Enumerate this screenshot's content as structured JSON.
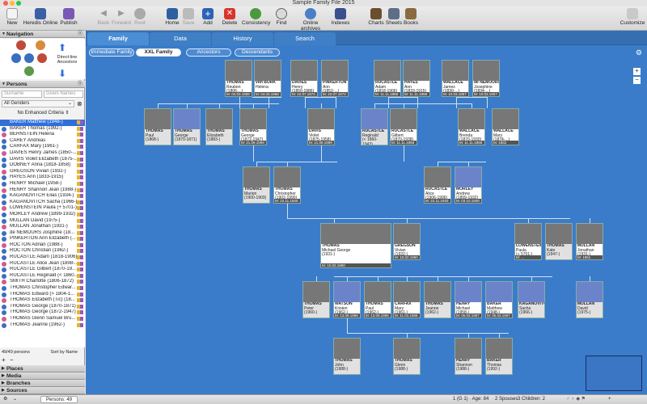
{
  "window": {
    "title": "Sample Family File 2015"
  },
  "toolbar": {
    "new": "New",
    "heredis_online": "Heredis Online",
    "publish": "Publish",
    "back": "Back",
    "forward": "Forward",
    "root": "Root",
    "home": "Home",
    "save": "Save",
    "add": "Add",
    "delete": "Delete",
    "consistency": "Consistency",
    "find": "Find",
    "online_archives": "Online archives",
    "indexes": "Indexes",
    "charts": "Charts",
    "sheets": "Sheets",
    "books": "Books",
    "customize": "Customize"
  },
  "navigation": {
    "title": "Navigation",
    "direct_line": "Direct-line Ancestors"
  },
  "persons": {
    "title": "Persons",
    "surname_placeholder": "Surname",
    "given_placeholder": "Given Names",
    "gender_filter": "All Genders",
    "criteria": "No Enhanced Criteria",
    "count": "49/49 persons",
    "sort": "Sort by Name",
    "items": [
      "BAKER Matthew (1948-)",
      "BAKER Thomas (1992-)",
      "BERNSTEIN Helena",
      "CAREY Andreas",
      "CARFAX Mary (1961-)",
      "DAVIES Henry James (1850-...",
      "DAVIS Violet Elizabeth (1875-...",
      "DOBNEY Anna (1818-1858)",
      "GREGSON Vivian (1932-)",
      "HAYES Ann (1833-1915)",
      "HENRY Michael (1958-)",
      "HENRY Shannon Jean (1988-)",
      "KAGANOVITCH Elias (1934-)",
      "KAGANOVITCH Sacha (1966-)",
      "LOWENSTEIN Paula (+ 5701-)",
      "MORLEY Andrew (1899-1932)",
      "MULLAN David (1975-)",
      "MULLAN Jonathan (1931-)",
      "de NEMOURS Josphine (18...",
      "PINKERTON Ann Elizabeth (...",
      "ROCTON Adrian (1988-)",
      "ROCTON Christian (1962-)",
      "RUCASTLE Adam (1818-1906)",
      "RUCASTLE Alice Jean (1898-...",
      "RUCASTLE Gilbert (1870-19...",
      "RUCASTLE Reginald (< 1860...",
      "SMITH Charlotte (1806-1872)",
      "THOMAS Christopher Edwar...",
      "THOMAS Edward (> 1804-1...",
      "THOMAS Elizabeth (Tic) (18...",
      "THOMAS George (1870-1871)",
      "THOMAS George (1872-1947)",
      "THOMAS Glenn Samuel Bru...",
      "THOMAS Jeanne (1962-)"
    ]
  },
  "sidebar_sections": {
    "places": "Places",
    "media": "Media",
    "branches": "Branches",
    "sources": "Sources"
  },
  "tabs": {
    "family": "Family",
    "data": "Data",
    "history": "History",
    "search": "Search"
  },
  "subtabs": {
    "immediate": "Immediate Family",
    "xxl": "XXL Family",
    "ancestors": "Ancestors",
    "descendants": "Descendants"
  },
  "cards": [
    {
      "n": "THOMAS",
      "g": "Reuben",
      "d": "(1806-...)",
      "s": "M: 04.03.1868",
      "sil": false
    },
    {
      "n": "von BORK",
      "g": "Helena",
      "d": "",
      "s": "M: 04.03.1868",
      "sil": false
    },
    {
      "n": "DAVIES",
      "g": "Henry",
      "d": "(1850-1886)",
      "s": "M: 22.07.1874",
      "sil": false
    },
    {
      "n": "PINKERTON",
      "g": "Ann",
      "d": "(1852-...)",
      "s": "M: 22.07.1874",
      "sil": false
    },
    {
      "n": "RUCASTLE",
      "g": "Adam",
      "d": "(1818-1906)",
      "s": "M: 11.11.1858",
      "sil": false
    },
    {
      "n": "HAYES",
      "g": "Ann",
      "d": "(1833-1915)",
      "s": "M: 11.11.1858",
      "sil": false
    },
    {
      "n": "WALLACE",
      "g": "James",
      "d": "(1830-...)",
      "s": "M: 10.03.1857",
      "sil": false
    },
    {
      "n": "de NEMOURS",
      "g": "Josephine",
      "d": "(1834-...)",
      "s": "M: 10.03.1857",
      "sil": false
    },
    {
      "n": "THOMAS",
      "g": "Paul",
      "d": "(1868-)",
      "s": "",
      "sil": false
    },
    {
      "n": "THOMAS",
      "g": "George",
      "d": "(1870-1871)",
      "s": "",
      "sil": true
    },
    {
      "n": "THOMAS",
      "g": "Elizabeth",
      "d": "(1883-)",
      "s": "",
      "sil": false
    },
    {
      "n": "THOMAS",
      "g": "George",
      "d": "(1872-1947)",
      "s": "M: 21.09.1899",
      "sil": false
    },
    {
      "n": "DAVIS",
      "g": "Violet",
      "d": "(1875-1958)",
      "s": "M: 21.09.1899",
      "sil": false
    },
    {
      "n": "RUCASTLE",
      "g": "Reginald",
      "d": "(< 1860-1943)",
      "s": "",
      "sil": true
    },
    {
      "n": "RUCASTLE",
      "g": "Gilbert",
      "d": "(1870-1938)",
      "s": "M: 11.11.1858",
      "sil": false
    },
    {
      "n": "WALLACE",
      "g": "Brenda",
      "d": "(1870-1930)",
      "s": "M: 11.11.1858",
      "sil": false
    },
    {
      "n": "WALLACE",
      "g": "Mary",
      "d": "(1874-...)",
      "s": "M: 1862",
      "sil": false
    },
    {
      "n": "THOMAS",
      "g": "Marion",
      "d": "(1900-1903)",
      "s": "",
      "sil": false
    },
    {
      "n": "THOMAS",
      "g": "Christopher",
      "d": "(1902-1990)",
      "s": "M: 22.11.1930",
      "sil": false
    },
    {
      "n": "RUCASTLE",
      "g": "Alice",
      "d": "(1906-1996)",
      "s": "M: 22.11.1930",
      "sil": false
    },
    {
      "n": "MORLEY",
      "g": "Andrew",
      "d": "(1899-1932)",
      "s": "M: 03.10.1928",
      "sil": true
    },
    {
      "n": "THOMAS",
      "g": "Michael George",
      "d": "(1931-)",
      "s": "M: 10.02.1960",
      "sil": false
    },
    {
      "n": "GREGSON",
      "g": "Vivian",
      "d": "(1932-)",
      "s": "M: 10.02.1960",
      "sil": false
    },
    {
      "n": "LOWENSTEIN",
      "g": "Paula",
      "d": "(+ 5701-)",
      "s": "M: ...",
      "sil": false
    },
    {
      "n": "THOMAS",
      "g": "Kate",
      "d": "(1947-)",
      "s": "",
      "sil": false
    },
    {
      "n": "MULLAN",
      "g": "Jonathan",
      "d": "(1931-)",
      "s": "M: 1961",
      "sil": false
    },
    {
      "n": "THOMAS",
      "g": "Peter",
      "d": "(1960-)",
      "s": "",
      "sil": false
    },
    {
      "n": "WATSON",
      "g": "Kristen",
      "d": "(1962-)",
      "s": "M: 13.09.1986",
      "sil": true
    },
    {
      "n": "THOMAS",
      "g": "Paul",
      "d": "(1962-)",
      "s": "M: 13.09.1986",
      "sil": false
    },
    {
      "n": "CARFAX",
      "g": "Mary",
      "d": "(1961-)",
      "s": "M: 11.03.1988",
      "sil": false
    },
    {
      "n": "THOMAS",
      "g": "Jeanne",
      "d": "(1962-)",
      "s": "",
      "sil": false
    },
    {
      "n": "HENRY",
      "g": "Michael",
      "d": "(1958-)",
      "s": "M: 05.03.1987",
      "sil": true
    },
    {
      "n": "BAKER",
      "g": "Matthew",
      "d": "(1948-)",
      "s": "M: 05.03.1987",
      "sil": true
    },
    {
      "n": "KAGANOVITCH",
      "g": "Sacha",
      "d": "(1966-)",
      "s": "",
      "sil": true
    },
    {
      "n": "MULLAN",
      "g": "David",
      "d": "(1975-)",
      "s": "",
      "sil": true
    },
    {
      "n": "THOMAS",
      "g": "John",
      "d": "(1988-)",
      "s": "",
      "sil": false
    },
    {
      "n": "THOMAS",
      "g": "Glenn",
      "d": "(1988-)",
      "s": "",
      "sil": false
    },
    {
      "n": "HENRY",
      "g": "Shannon",
      "d": "(1988-)",
      "s": "",
      "sil": false
    },
    {
      "n": "BAKER",
      "g": "Thomas",
      "d": "(1992-)",
      "s": "",
      "sil": false
    }
  ],
  "status": {
    "persons": "Persons: 49",
    "info": "1 (G 1) · Age: 84",
    "spouses": "2 Spouses",
    "children": "3 Children: 2"
  }
}
